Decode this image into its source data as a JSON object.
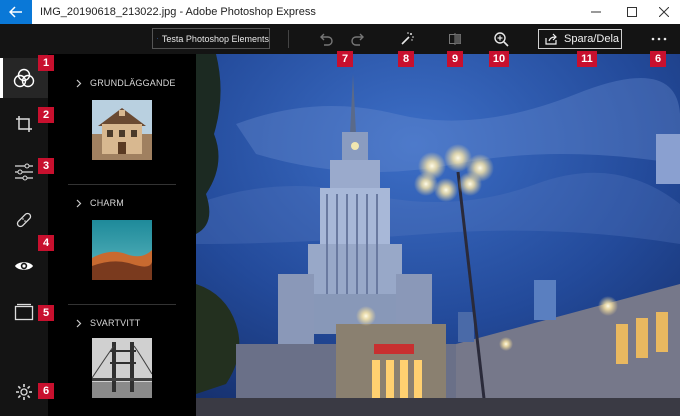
{
  "window": {
    "title": "IMG_20190618_213022.jpg - Adobe Photoshop Express"
  },
  "toolbar": {
    "try_button_label": "Testa Photoshop Elements",
    "share_button_label": "Spara/Dela"
  },
  "left_rail": {
    "items": [
      {
        "icon": "looks-circles-icon",
        "active": true
      },
      {
        "icon": "crop-icon",
        "active": false
      },
      {
        "icon": "adjust-sliders-icon",
        "active": false
      },
      {
        "icon": "healing-bandage-icon",
        "active": false
      },
      {
        "icon": "eye-icon",
        "active": false
      },
      {
        "icon": "border-frame-icon",
        "active": false
      },
      {
        "icon": "settings-gear-icon",
        "active": false
      }
    ]
  },
  "panel": {
    "categories": [
      {
        "label": "GRUNDLÄGGANDE"
      },
      {
        "label": "CHARM"
      },
      {
        "label": "SVARTVITT"
      }
    ]
  },
  "callouts": [
    "1",
    "2",
    "3",
    "4",
    "5",
    "6",
    "7",
    "8",
    "9",
    "10",
    "11",
    "6"
  ],
  "colors": {
    "accent_blue": "#0a78d7",
    "callout_red": "#c8102e",
    "toolbar_bg": "#141414"
  }
}
